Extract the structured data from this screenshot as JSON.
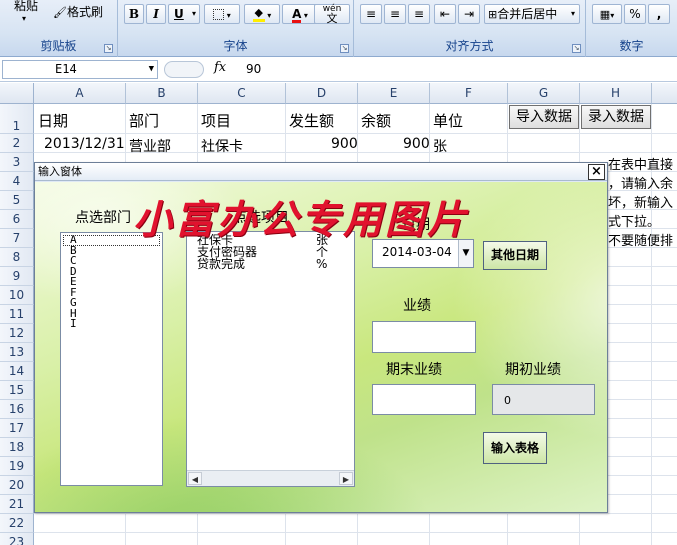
{
  "ribbon": {
    "paste_label": "粘贴",
    "format_painter_label": "格式刷",
    "clipboard_group": "剪贴板",
    "font_group": "字体",
    "align_group": "对齐方式",
    "number_group": "数字",
    "bold": "B",
    "italic": "I",
    "underline": "U",
    "font_color_glyph": "A",
    "phonetic_glyph": "wén",
    "merge_center_label": "合并后居中",
    "percent_glyph": "%",
    "comma_glyph": ","
  },
  "formula_bar": {
    "name_box": "E14",
    "fx_label": "fx",
    "value": "90"
  },
  "grid": {
    "columns": [
      "A",
      "B",
      "C",
      "D",
      "E",
      "F",
      "G",
      "H"
    ],
    "rows": [
      "1",
      "2",
      "3",
      "4",
      "5",
      "6",
      "7",
      "8",
      "9",
      "10",
      "11",
      "12",
      "13",
      "14",
      "15",
      "16",
      "17",
      "18",
      "19",
      "20",
      "21",
      "22",
      "23"
    ],
    "header_row": {
      "date": "日期",
      "dept": "部门",
      "item": "项目",
      "amount": "发生额",
      "balance": "余额",
      "unit": "单位"
    },
    "row2": {
      "date": "2013/12/31",
      "dept": "营业部",
      "item": "社保卡",
      "amount": "900",
      "balance": "900",
      "unit": "张"
    },
    "import_button": "导入数据",
    "entry_button": "录入数据",
    "note_lines": [
      "在表中直接",
      "，请输入余",
      "坏，新输入",
      "式下拉。",
      "不要随便排"
    ]
  },
  "dialog": {
    "title": "输入窗体",
    "close_glyph": "×",
    "watermark": "小富办公专用图片",
    "dept_label": "点选部门",
    "dept_items": [
      "A",
      "B",
      "C",
      "D",
      "E",
      "F",
      "G",
      "H",
      "I"
    ],
    "project_label": "点选项目",
    "project_items": [
      {
        "name": "社保卡",
        "unit": "张"
      },
      {
        "name": "支付密码器",
        "unit": "个"
      },
      {
        "name": "贷款完成",
        "unit": "%"
      }
    ],
    "date_label": "日期",
    "date_value": "2014-03-04",
    "other_date_button": "其他日期",
    "performance_label": "业绩",
    "end_performance_label": "期末业绩",
    "start_performance_label": "期初业绩",
    "start_performance_value": "0",
    "submit_button": "输入表格"
  }
}
